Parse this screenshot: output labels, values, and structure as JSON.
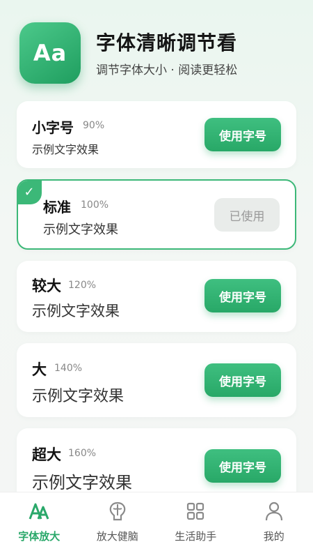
{
  "app": {
    "logo_text": "Aa",
    "title": "字体清晰调节看",
    "subtitle": "调节字体大小 · 阅读更轻松"
  },
  "font_options": [
    {
      "name": "小字号",
      "percent": "90%",
      "sample": "示例文字效果",
      "button": "使用字号",
      "selected": false
    },
    {
      "name": "标准",
      "percent": "100%",
      "sample": "示例文字效果",
      "button": "已使用",
      "selected": true
    },
    {
      "name": "较大",
      "percent": "120%",
      "sample": "示例文字效果",
      "button": "使用字号",
      "selected": false
    },
    {
      "name": "大",
      "percent": "140%",
      "sample": "示例文字效果",
      "button": "使用字号",
      "selected": false
    },
    {
      "name": "超大",
      "percent": "160%",
      "sample": "示例文字效果",
      "button": "使用字号",
      "selected": false
    }
  ],
  "check_glyph": "✓",
  "tabs": [
    {
      "label": "字体放大",
      "icon": "font-scale-icon",
      "active": true
    },
    {
      "label": "放大健脑",
      "icon": "brain-icon",
      "active": false
    },
    {
      "label": "生活助手",
      "icon": "grid-apps-icon",
      "active": false
    },
    {
      "label": "我的",
      "icon": "profile-icon",
      "active": false
    }
  ],
  "colors": {
    "accent": "#2aa86a",
    "inactive_icon": "#8a8a8a"
  }
}
